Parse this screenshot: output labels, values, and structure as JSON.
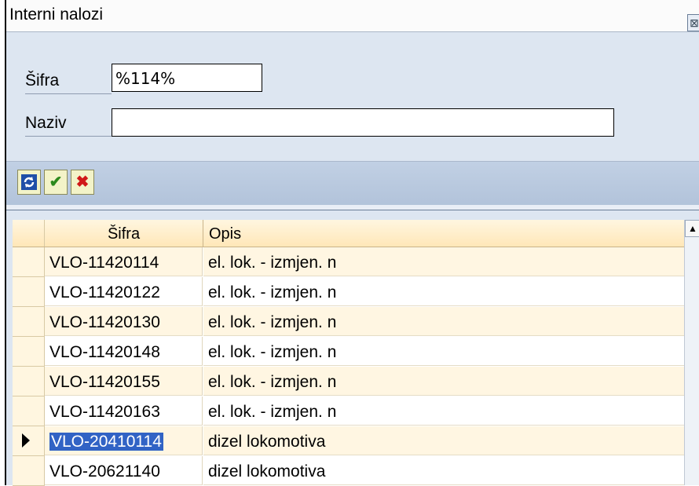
{
  "window": {
    "title": "Interni nalozi",
    "close_glyph": "⊠"
  },
  "form": {
    "sifra_label": "Šifra",
    "sifra_value": "%114%",
    "naziv_label": "Naziv",
    "naziv_value": ""
  },
  "toolbar": {
    "buttons": [
      {
        "icon": "refresh-icon"
      },
      {
        "icon": "check-icon"
      },
      {
        "icon": "cancel-icon"
      }
    ]
  },
  "grid": {
    "columns": [
      "Šifra",
      "Opis"
    ],
    "rows": [
      {
        "sifra": "VLO-11420114",
        "opis": "el. lok. - izmjen. n"
      },
      {
        "sifra": "VLO-11420122",
        "opis": "el. lok. - izmjen. n"
      },
      {
        "sifra": "VLO-11420130",
        "opis": "el. lok. - izmjen. n"
      },
      {
        "sifra": "VLO-11420148",
        "opis": "el. lok. - izmjen. n"
      },
      {
        "sifra": "VLO-11420155",
        "opis": "el. lok. - izmjen. n"
      },
      {
        "sifra": "VLO-11420163",
        "opis": "el. lok. - izmjen. n"
      },
      {
        "sifra": "VLO-20410114",
        "opis": "dizel lokomotiva"
      },
      {
        "sifra": "VLO-20621140",
        "opis": "dizel lokomotiva"
      }
    ],
    "selected_index": 6
  }
}
